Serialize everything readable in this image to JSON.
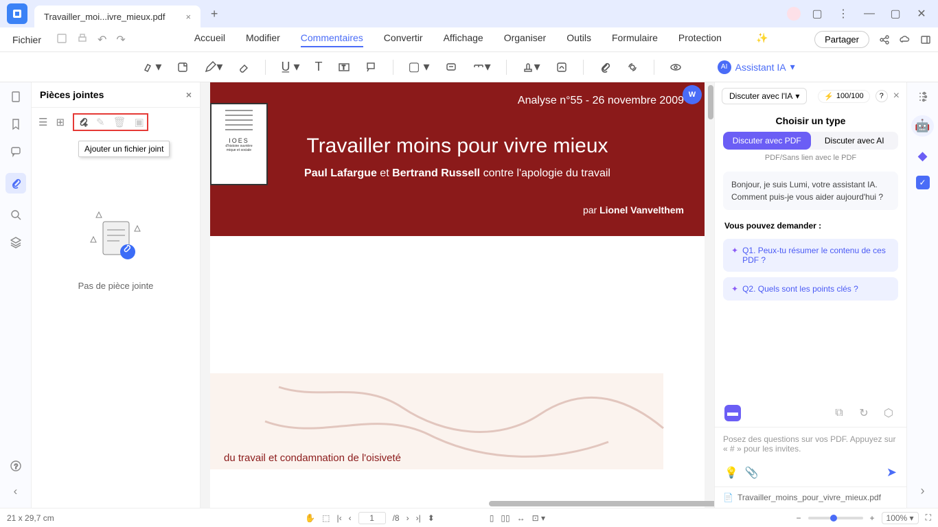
{
  "titlebar": {
    "tab_name": "Travailler_moi...ivre_mieux.pdf"
  },
  "menubar": {
    "file": "Fichier",
    "items": [
      "Accueil",
      "Modifier",
      "Commentaires",
      "Convertir",
      "Affichage",
      "Organiser",
      "Outils",
      "Formulaire",
      "Protection"
    ],
    "share": "Partager"
  },
  "ai_assistant_label": "Assistant IA",
  "attach": {
    "title": "Pièces jointes",
    "tooltip": "Ajouter un fichier joint",
    "empty": "Pas de pièce jointe"
  },
  "pdf": {
    "analysis": "Analyse n°55 - 26 novembre 2009",
    "title": "Travailler moins pour vivre mieux",
    "subtitle_before": "Paul Lafargue",
    "subtitle_et": " et ",
    "subtitle_mid": "Bertrand Russell",
    "subtitle_after": " contre l'apologie du travail",
    "author_prefix": "par ",
    "author": "Lionel Vanvelthem",
    "section": "du travail et condamnation de l'oisiveté",
    "word_badge": "W"
  },
  "ai": {
    "dropdown": "Discuter avec l'IA",
    "tokens": "100/100",
    "choose": "Choisir un type",
    "toggle_pdf": "Discuter avec PDF",
    "toggle_ia": "Discuter avec AI",
    "caption": "PDF/Sans lien avec le PDF",
    "greeting": "Bonjour, je suis Lumi, votre assistant IA. Comment puis-je vous aider aujourd'hui ?",
    "suggest_hdr": "Vous pouvez demander :",
    "q1": "Q1. Peux-tu résumer le contenu de ces PDF ?",
    "q2": "Q2. Quels sont les points clés ?",
    "input_placeholder": "Posez des questions sur vos PDF. Appuyez sur « # » pour les invites.",
    "footer_file": "Travailler_moins_pour_vivre_mieux.pdf"
  },
  "status": {
    "dimensions": "21 x 29,7 cm",
    "page_current": "1",
    "page_total": "/8",
    "zoom": "100%"
  }
}
